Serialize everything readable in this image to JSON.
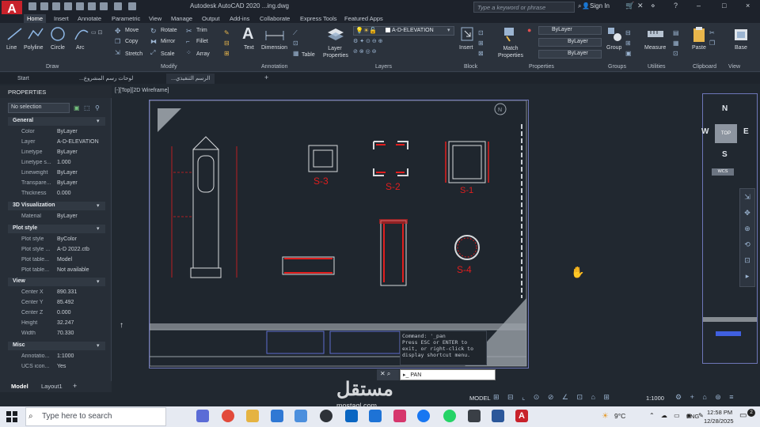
{
  "titlebar": {
    "app_logo": "A",
    "title": "Autodesk AutoCAD 2020   ...ing.dwg",
    "search_placeholder": "Type a keyword or phrase",
    "sign_in": "Sign In",
    "window_controls": [
      "–",
      "□",
      "×"
    ]
  },
  "menu": [
    "Home",
    "Insert",
    "Annotate",
    "Parametric",
    "View",
    "Manage",
    "Output",
    "Add-ins",
    "Collaborate",
    "Express Tools",
    "Featured Apps"
  ],
  "ribbon": {
    "draw": {
      "line": "Line",
      "polyline": "Polyline",
      "circle": "Circle",
      "arc": "Arc",
      "panel": "Draw"
    },
    "modify": {
      "move": "Move",
      "copy": "Copy",
      "stretch": "Stretch",
      "rotate": "Rotate",
      "mirror": "Mirror",
      "scale": "Scale",
      "trim": "Trim",
      "fillet": "Fillet",
      "array": "Array",
      "panel": "Modify"
    },
    "annotation": {
      "text": "Text",
      "dimension": "Dimension",
      "table": "Table",
      "panel": "Annotation"
    },
    "layers": {
      "layer_properties": "Layer Properties",
      "current_layer": "A-D-ELEVATION",
      "panel": "Layers"
    },
    "block": {
      "insert": "Insert",
      "panel": "Block"
    },
    "properties": {
      "match": "Match Properties",
      "bylayer1": "ByLayer",
      "bylayer2": "ByLayer",
      "bylayer3": "ByLayer",
      "panel": "Properties"
    },
    "groups": {
      "group": "Group",
      "panel": "Groups"
    },
    "utilities": {
      "measure": "Measure",
      "panel": "Utilities"
    },
    "clipboard": {
      "paste": "Paste",
      "panel": "Clipboard"
    },
    "view": {
      "base": "Base",
      "panel": "View"
    }
  },
  "file_tabs": [
    "Start",
    "...لوحات رسم المشروع",
    "...الرسم التنفيذي"
  ],
  "properties": {
    "header": "PROPERTIES",
    "selection": "No selection",
    "general": {
      "title": "General",
      "rows": [
        [
          "Color",
          "ByLayer"
        ],
        [
          "Layer",
          "A-D-ELEVATION"
        ],
        [
          "Linetype",
          "ByLayer"
        ],
        [
          "Linetype s...",
          "1.000"
        ],
        [
          "Lineweight",
          "ByLayer"
        ],
        [
          "Transpare...",
          "ByLayer"
        ],
        [
          "Thickness",
          "0.000"
        ]
      ]
    },
    "viz3d": {
      "title": "3D Visualization",
      "rows": [
        [
          "Material",
          "ByLayer"
        ]
      ]
    },
    "plot": {
      "title": "Plot style",
      "rows": [
        [
          "Plot style",
          "ByColor"
        ],
        [
          "Plot style ...",
          "A-D 2022.ctb"
        ],
        [
          "Plot table...",
          "Model"
        ],
        [
          "Plot table...",
          "Not available"
        ]
      ]
    },
    "view": {
      "title": "View",
      "rows": [
        [
          "Center X",
          "890.331"
        ],
        [
          "Center Y",
          "85.492"
        ],
        [
          "Center Z",
          "0.000"
        ],
        [
          "Height",
          "32.247"
        ],
        [
          "Width",
          "70.330"
        ]
      ]
    },
    "misc": {
      "title": "Misc",
      "rows": [
        [
          "Annotatio...",
          "1:1000"
        ],
        [
          "UCS icon...",
          "Yes"
        ]
      ]
    }
  },
  "viewport_label": "[-][Top][2D Wireframe]",
  "sections": [
    "S-3",
    "S-2",
    "S-1",
    "S-4"
  ],
  "viewcube": {
    "n": "N",
    "s": "S",
    "e": "E",
    "w": "W",
    "top": "TOP",
    "wcs": "WCS"
  },
  "command": {
    "history": [
      "Command: '_pan",
      "Press ESC or ENTER to",
      "exit, or right-click to",
      "display shortcut menu."
    ],
    "input": "PAN"
  },
  "layout_tabs": [
    "Model",
    "Layout1",
    "+"
  ],
  "status": {
    "model": "MODEL",
    "scale": "1:1000"
  },
  "taskbar": {
    "search_placeholder": "Type here to search",
    "weather": "9°C",
    "lang": "ENG",
    "time": "12:58 PM",
    "date": "12/28/2025",
    "notifications": "2"
  },
  "watermark": {
    "main": "مستقل",
    "sub": "mostaql.com"
  },
  "colors": {
    "accent": "#c8222b",
    "drawing_red": "#e01e1e",
    "viewport_border": "#6e76b8"
  }
}
